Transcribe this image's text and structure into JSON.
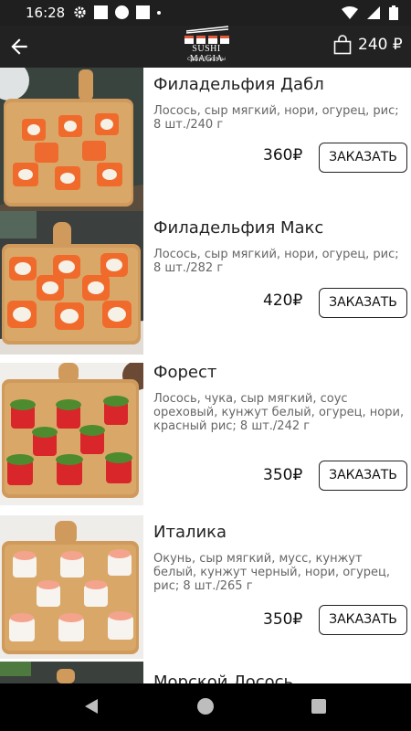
{
  "status_bar": {
    "time": "16:28",
    "icons": [
      "gear-icon",
      "square-icon",
      "circle-icon",
      "square-icon",
      "dot-icon"
    ],
    "right_icons": [
      "wifi-icon",
      "signal-icon",
      "battery-icon"
    ]
  },
  "header": {
    "back_icon": "arrow-left-icon",
    "logo_name": "SUSHI MAGIA",
    "logo_tagline": "суши | роллы",
    "cart_icon": "shopping-bag-icon",
    "cart_total": "240 ₽"
  },
  "products": [
    {
      "name": "Филадельфия Дабл",
      "description": "Лосось, сыр мягкий, нори, огурец, рис; 8 шт./240 г",
      "price": "360₽",
      "order_label": "ЗАКАЗАТЬ"
    },
    {
      "name": "Филадельфия Макс",
      "description": "Лосось, сыр мягкий, нори, огурец, рис; 8 шт./282 г",
      "price": "420₽",
      "order_label": "ЗАКАЗАТЬ"
    },
    {
      "name": "Форест",
      "description": "Лосось, чука, сыр мягкий, соус ореховый, кунжут белый, огурец, нори, красный рис; 8 шт./242 г",
      "price": "350₽",
      "order_label": "ЗАКАЗАТЬ"
    },
    {
      "name": "Италика",
      "description": "Окунь, сыр мягкий, мусс, кунжут белый, кунжут черный, нори, огурец, рис; 8 шт./265 г",
      "price": "350₽",
      "order_label": "ЗАКАЗАТЬ"
    },
    {
      "name": "Морской Лосось"
    }
  ],
  "nav_bar": {
    "icons": [
      "back-triangle-icon",
      "home-circle-icon",
      "recents-square-icon"
    ]
  },
  "colors": {
    "app_bar": "#222222",
    "status_bar": "#1f1f1f",
    "board": "#cf9a5c",
    "salmon": "#f06a2c",
    "tobiko": "#d8262b"
  }
}
